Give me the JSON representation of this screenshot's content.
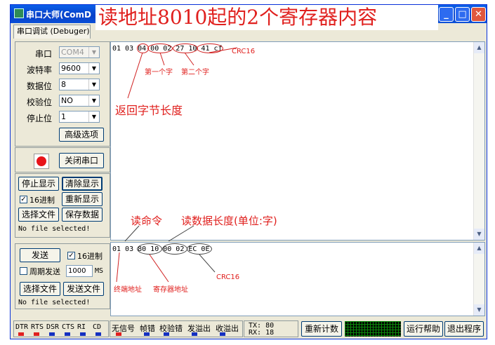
{
  "window": {
    "title": "串口大师(ComD",
    "overlay_heading": "读地址8010起的2个寄存器内容"
  },
  "tab": "串口调试 (Debuger)",
  "settings": {
    "port_label": "串口",
    "port_value": "COM4",
    "baud_label": "波特率",
    "baud_value": "9600",
    "databits_label": "数据位",
    "databits_value": "8",
    "parity_label": "校验位",
    "parity_value": "NO",
    "stopbits_label": "停止位",
    "stopbits_value": "1",
    "advanced_label": "高级选项"
  },
  "serial": {
    "close_port_label": "关闭串口",
    "led_color": "#E8141A"
  },
  "receive": {
    "stop_label": "停止显示",
    "clear_label": "清除显示",
    "hex_label": "16进制",
    "redisplay_label": "重新显示",
    "select_file_label": "选择文件",
    "save_label": "保存数据",
    "file_status": "No file selected!",
    "text": "01 03 04 00 02 27 10 41 cf"
  },
  "send": {
    "send_label": "发送",
    "hex_label": "16进制",
    "periodic_label": "周期发送",
    "period_value": "1000",
    "period_unit": "MS",
    "select_file_label": "选择文件",
    "send_file_label": "发送文件",
    "file_status": "No file selected!",
    "text": "01 03 80 10 00 02 EC 0E"
  },
  "annotations": {
    "crc16_rx": "CRC16",
    "first_word": "第一个字",
    "second_word": "第二个字",
    "return_len": "返回字节长度",
    "read_cmd": "读命令",
    "read_len": "读数据长度(单位:字)",
    "terminal_addr": "终端地址",
    "register_addr": "寄存器地址",
    "crc16_tx": "CRC16"
  },
  "statusbar": {
    "signals": [
      "DTR",
      "RTS",
      "DSR",
      "CTS",
      "RI",
      "CD"
    ],
    "signal_colors": [
      "#E02020",
      "#E02020",
      "#1530C0",
      "#1530C0",
      "#1530C0",
      "#1530C0"
    ],
    "errors": [
      "无信号",
      "帧错",
      "校验错",
      "发溢出",
      "收溢出"
    ],
    "error_colors": [
      "#E02020",
      "#1530C0",
      "#1530C0",
      "#1530C0",
      "#1530C0"
    ],
    "tx": "TX: 80",
    "rx": "RX: 18",
    "recount_label": "重新计数",
    "help_label": "运行帮助",
    "exit_label": "退出程序"
  }
}
